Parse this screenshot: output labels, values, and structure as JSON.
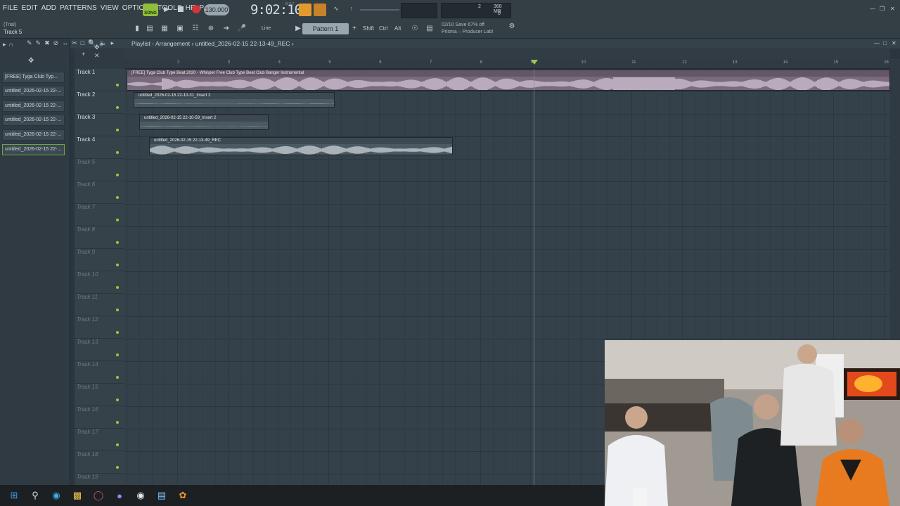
{
  "menu": [
    "FILE",
    "EDIT",
    "ADD",
    "PATTERNS",
    "VIEW",
    "OPTIONS",
    "TOOLS",
    "HELP"
  ],
  "hint": {
    "trial": "(Trial)",
    "track": "Track 5"
  },
  "transport": {
    "mode": "SONG",
    "tempo": "130.000",
    "time": "9:02:10",
    "time_sub": "B:S:T"
  },
  "cpu": {
    "memory": "360 MB",
    "voices": "2",
    "cpu": "0"
  },
  "toolbar2": {
    "line_mode": "Line",
    "pattern": "Pattern 1",
    "shift": "Shift",
    "ctrl": "Ctrl",
    "alt": "Alt"
  },
  "news": {
    "line1": "02/10  Save 67% off",
    "line2": "Prisma – Producer Lab!"
  },
  "playlist": {
    "window_title": "Playlist - Arrangement",
    "breadcrumb": "untitled_2026-02-15 22-13-49_REC",
    "ruler_ticks": [
      "2",
      "3",
      "4",
      "5",
      "6",
      "7",
      "8",
      "9",
      "10",
      "11",
      "12",
      "13",
      "14",
      "15",
      "16"
    ]
  },
  "channel_clips": [
    "[FREE] Tyga Club Typ...",
    "untitled_2026-02-15 22-...",
    "untitled_2026-02-15 22-...",
    "untitled_2026-02-15 22-...",
    "untitled_2026-02-15 22-...",
    "untitled_2026-02-15 22-..."
  ],
  "tracks": [
    "Track 1",
    "Track 2",
    "Track 3",
    "Track 4",
    "Track 5",
    "Track 6",
    "Track 7",
    "Track 8",
    "Track 9",
    "Track 10",
    "Track 11",
    "Track 12",
    "Track 13",
    "Track 14",
    "Track 15",
    "Track 16",
    "Track 17",
    "Track 18",
    "Track 19"
  ],
  "clips": [
    {
      "title": "[FREE] Tyga Club Type Beat 2020 - Whisper  Free Club Type Beat  Club Banger Instrumental",
      "color": "#7a6a7d"
    },
    {
      "title": "untitled_2026-02-15 22-10-31_Insert 2",
      "color": "#4b5962"
    },
    {
      "title": "untitled_2026-02-15 22-10-59_Insert 2",
      "color": "#4b5962"
    },
    {
      "title": "untitled_2026-02-15 22-13-49_REC",
      "color": "#4b5962"
    }
  ],
  "colors": {
    "accent_green": "#8fcf3a",
    "record_red": "#d2343a",
    "orange": "#e39a2d"
  }
}
